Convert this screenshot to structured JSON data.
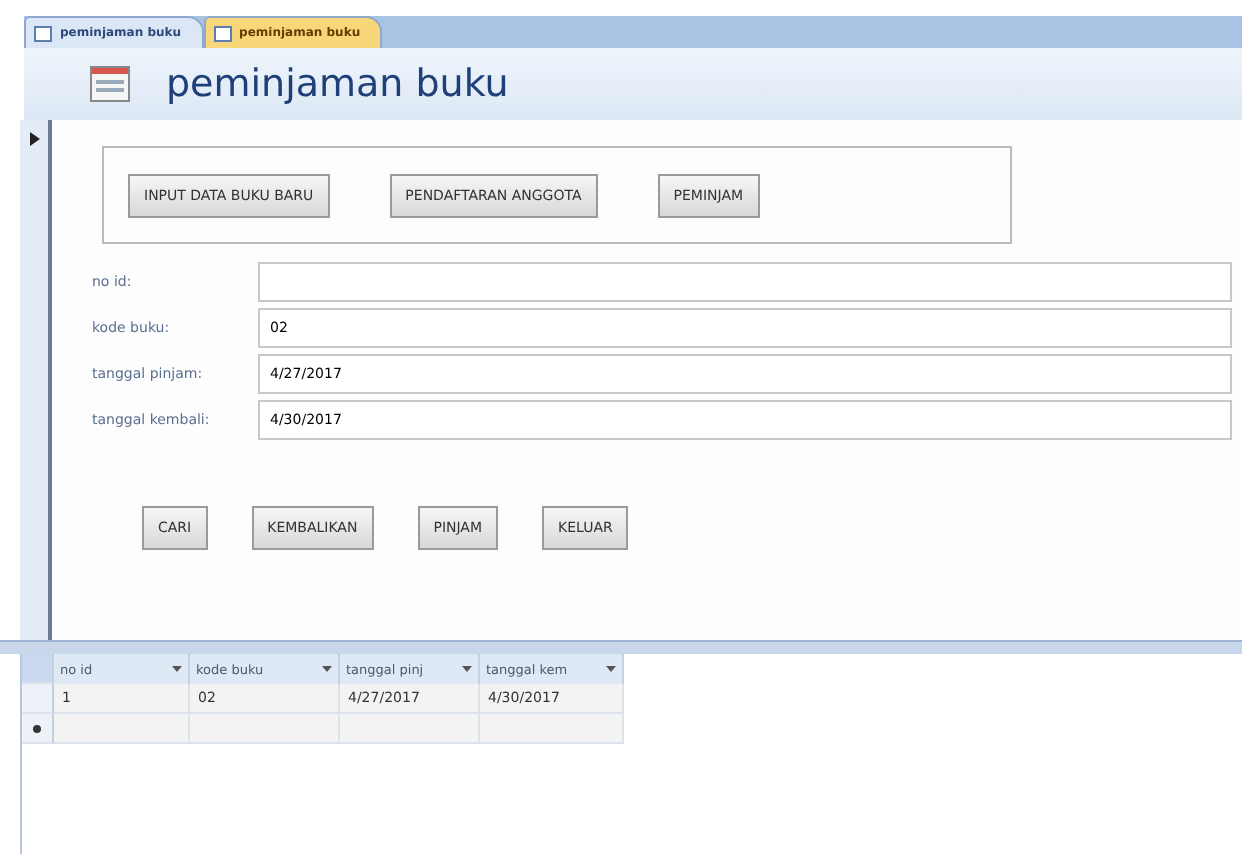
{
  "tabs": [
    {
      "label": "peminjaman buku",
      "selected": false
    },
    {
      "label": "peminjaman buku",
      "selected": true
    }
  ],
  "form_title": "peminjaman buku",
  "nav_buttons": [
    "INPUT DATA BUKU BARU",
    "PENDAFTARAN ANGGOTA",
    "PEMINJAM"
  ],
  "fields": [
    {
      "label": "no id:"
    },
    {
      "label": "kode buku:",
      "value": "02"
    },
    {
      "label": "tanggal pinjam:",
      "value": "4/27/2017"
    },
    {
      "label": "tanggal kembali:",
      "value": "4/30/2017"
    }
  ],
  "action_buttons": [
    "CARI",
    "KEMBALIKAN",
    "PINJAM",
    "KELUAR"
  ],
  "datasheet": {
    "columns": [
      "no id",
      "kode buku",
      "tanggal pinj",
      "tanggal kem"
    ],
    "rows": [
      [
        "1",
        "02",
        "4/27/2017",
        "4/30/2017"
      ]
    ]
  }
}
